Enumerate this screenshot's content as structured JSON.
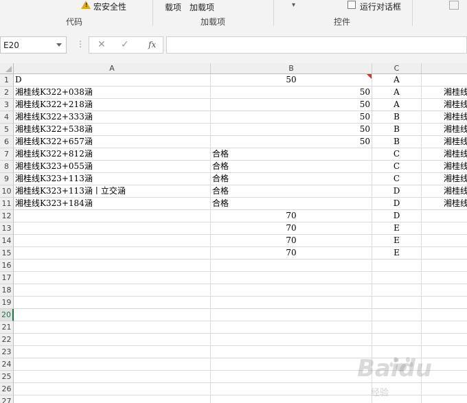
{
  "ribbon": {
    "safety_label": "宏安全性",
    "item1": "载项",
    "item2": "加载项",
    "dropdown": "▾",
    "run_dialog": "运行对话框",
    "group_code": "代码",
    "group_addins": "加载项",
    "group_controls": "控件"
  },
  "formula_bar": {
    "cell_ref": "E20",
    "cancel": "✕",
    "enter": "✓",
    "fx": "fx",
    "formula": ""
  },
  "columns": [
    "A",
    "B",
    "C",
    ""
  ],
  "rows": [
    {
      "num": "1",
      "a": "D",
      "b": "50",
      "b_align": "c",
      "c": "A",
      "d": "",
      "comment": true
    },
    {
      "num": "2",
      "a": "湘桂线K322+038涵",
      "b": "50",
      "b_align": "r",
      "c": "A",
      "d": "湘桂线"
    },
    {
      "num": "3",
      "a": "湘桂线K322+218涵",
      "b": "50",
      "b_align": "r",
      "c": "A",
      "d": "湘桂线"
    },
    {
      "num": "4",
      "a": "湘桂线K322+333涵",
      "b": "50",
      "b_align": "r",
      "c": "B",
      "d": "湘桂线"
    },
    {
      "num": "5",
      "a": "湘桂线K322+538涵",
      "b": "50",
      "b_align": "r",
      "c": "B",
      "d": "湘桂线"
    },
    {
      "num": "6",
      "a": "湘桂线K322+657涵",
      "b": "50",
      "b_align": "r",
      "c": "B",
      "d": "湘桂线"
    },
    {
      "num": "7",
      "a": "湘桂线K322+812涵",
      "b": "合格",
      "b_align": "l",
      "c": "C",
      "d": "湘桂线"
    },
    {
      "num": "8",
      "a": "湘桂线K323+055涵",
      "b": "合格",
      "b_align": "l",
      "c": "C",
      "d": "湘桂线"
    },
    {
      "num": "9",
      "a": "湘桂线K323+113涵",
      "b": "合格",
      "b_align": "l",
      "c": "C",
      "d": "湘桂线"
    },
    {
      "num": "10",
      "a": "湘桂线K323+113涵丨立交涵",
      "b": "合格",
      "b_align": "l",
      "c": "D",
      "d": "湘桂线"
    },
    {
      "num": "11",
      "a": "湘桂线K323+184涵",
      "b": "合格",
      "b_align": "l",
      "c": "D",
      "d": "湘桂线"
    },
    {
      "num": "12",
      "a": "",
      "b": "70",
      "b_align": "c",
      "c": "D",
      "d": ""
    },
    {
      "num": "13",
      "a": "",
      "b": "70",
      "b_align": "c",
      "c": "E",
      "d": ""
    },
    {
      "num": "14",
      "a": "",
      "b": "70",
      "b_align": "c",
      "c": "E",
      "d": ""
    },
    {
      "num": "15",
      "a": "",
      "b": "70",
      "b_align": "c",
      "c": "E",
      "d": ""
    },
    {
      "num": "16",
      "a": "",
      "b": "",
      "b_align": "c",
      "c": "",
      "d": ""
    },
    {
      "num": "17",
      "a": "",
      "b": "",
      "b_align": "c",
      "c": "",
      "d": ""
    },
    {
      "num": "18",
      "a": "",
      "b": "",
      "b_align": "c",
      "c": "",
      "d": ""
    },
    {
      "num": "19",
      "a": "",
      "b": "",
      "b_align": "c",
      "c": "",
      "d": ""
    },
    {
      "num": "20",
      "a": "",
      "b": "",
      "b_align": "c",
      "c": "",
      "d": "",
      "selected": true
    },
    {
      "num": "21",
      "a": "",
      "b": "",
      "b_align": "c",
      "c": "",
      "d": ""
    },
    {
      "num": "22",
      "a": "",
      "b": "",
      "b_align": "c",
      "c": "",
      "d": ""
    },
    {
      "num": "23",
      "a": "",
      "b": "",
      "b_align": "c",
      "c": "",
      "d": ""
    },
    {
      "num": "24",
      "a": "",
      "b": "",
      "b_align": "c",
      "c": "",
      "d": ""
    },
    {
      "num": "25",
      "a": "",
      "b": "",
      "b_align": "c",
      "c": "",
      "d": ""
    },
    {
      "num": "26",
      "a": "",
      "b": "",
      "b_align": "c",
      "c": "",
      "d": ""
    },
    {
      "num": "27",
      "a": "",
      "b": "",
      "b_align": "c",
      "c": "",
      "d": ""
    }
  ],
  "watermark": {
    "logo": "Baidu",
    "sub": "经验"
  },
  "colors": {
    "accent": "#217346",
    "comment": "#c0392b",
    "header_bg": "#efefef"
  }
}
